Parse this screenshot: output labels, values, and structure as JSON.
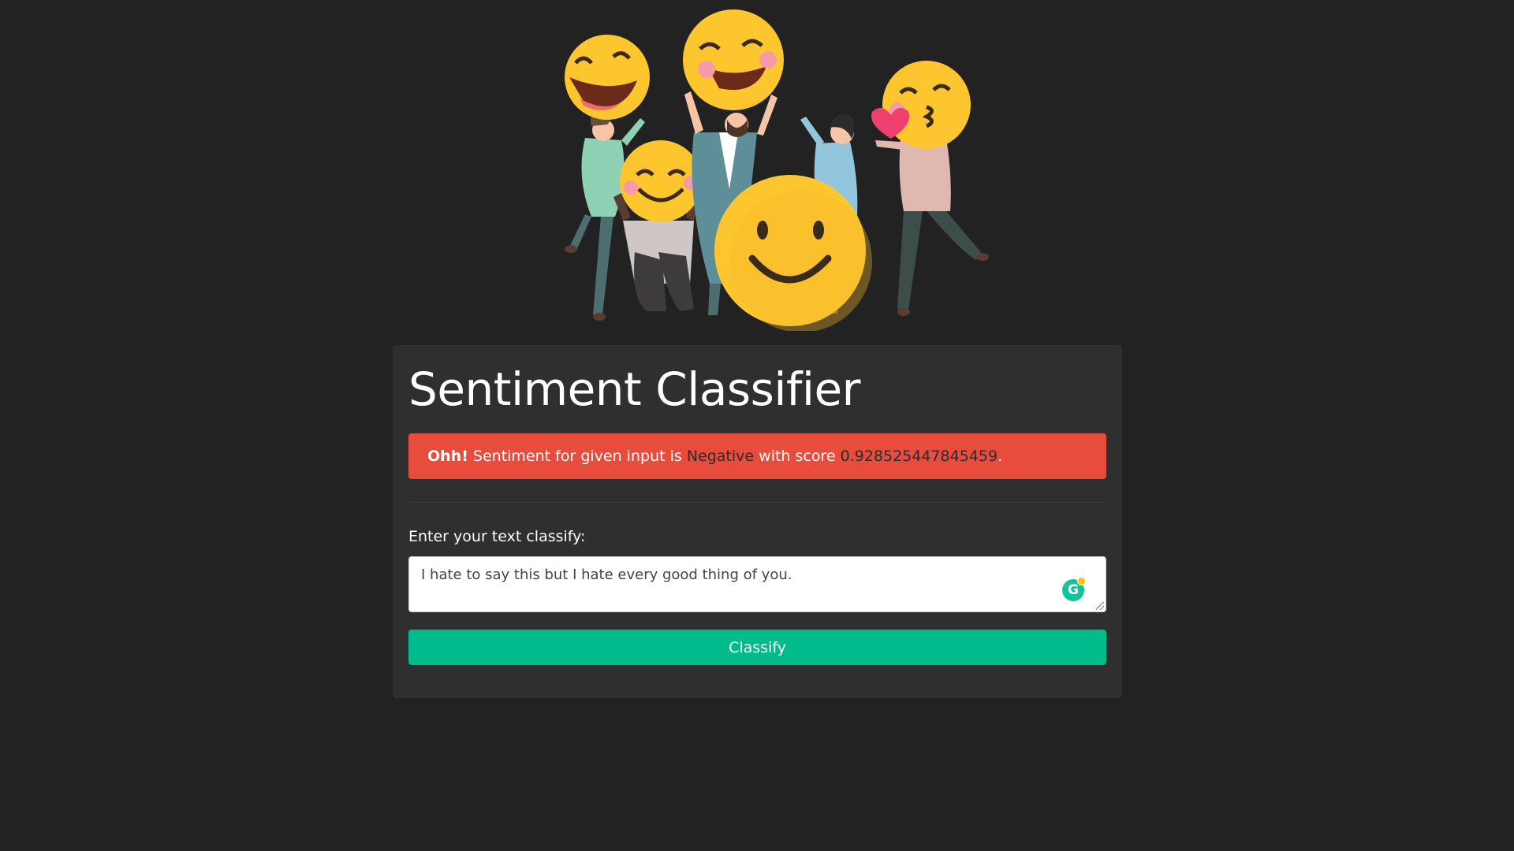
{
  "hero": {
    "icon": "smiling-emoji-people-illustration"
  },
  "card": {
    "title": "Sentiment Classifier",
    "alert": {
      "prefix": "Ohh!",
      "text_before": " Sentiment for given input is ",
      "sentiment": "Negative",
      "text_middle": " with score ",
      "score": "0.928525447845459",
      "text_after": ".",
      "color": "#e74c3c"
    },
    "input_label": "Enter your text classify:",
    "input_value": "I hate to say this but I hate every good thing of you.",
    "classify_button": "Classify",
    "button_color": "#00bc8c",
    "grammarly_icon": "grammarly-icon"
  }
}
